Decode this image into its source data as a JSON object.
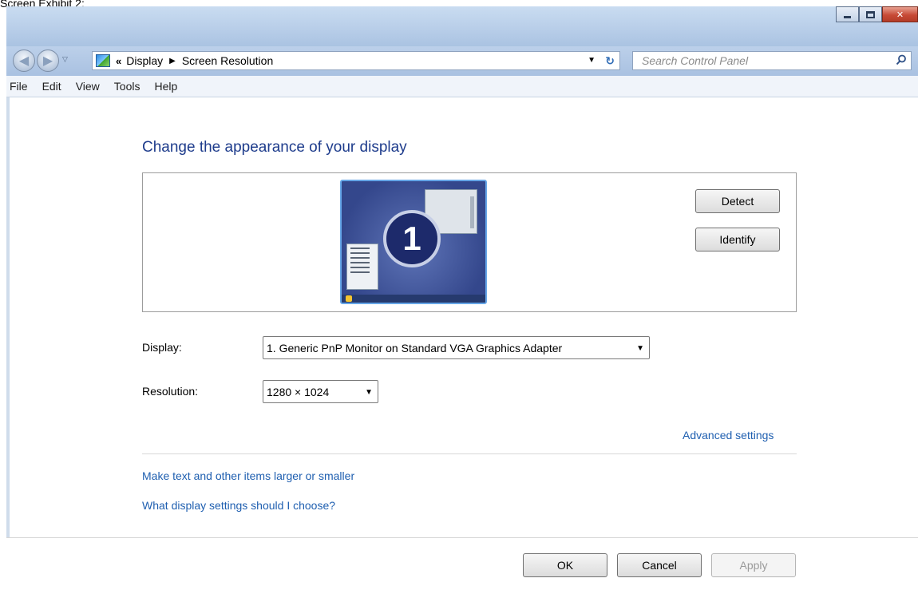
{
  "caption": "Screen Exhibit 2:",
  "window": {
    "controls": {
      "minimize": "minimize",
      "maximize": "maximize",
      "close": "✕"
    },
    "address": {
      "chevron": "«",
      "crumbs": [
        "Display",
        "Screen Resolution"
      ]
    },
    "search": {
      "placeholder": "Search Control Panel"
    }
  },
  "menu": [
    "File",
    "Edit",
    "View",
    "Tools",
    "Help"
  ],
  "main": {
    "heading": "Change the appearance of your display",
    "monitor_number": "1",
    "detect_label": "Detect",
    "identify_label": "Identify",
    "display_label": "Display:",
    "display_value": "1. Generic PnP Monitor on Standard VGA Graphics Adapter",
    "resolution_label": "Resolution:",
    "resolution_value": "1280 × 1024",
    "advanced_link": "Advanced settings",
    "link_text_size": "Make text and other items larger or smaller",
    "link_help": "What display settings should I choose?"
  },
  "footer": {
    "ok": "OK",
    "cancel": "Cancel",
    "apply": "Apply"
  },
  "colors": {
    "link": "#1f5fb0",
    "heading": "#1e3c8c",
    "titlebar": "#b7cde8"
  },
  "icons": [
    "back-arrow-icon",
    "forward-arrow-icon",
    "control-panel-icon",
    "refresh-icon",
    "search-icon",
    "chevron-down-icon"
  ]
}
